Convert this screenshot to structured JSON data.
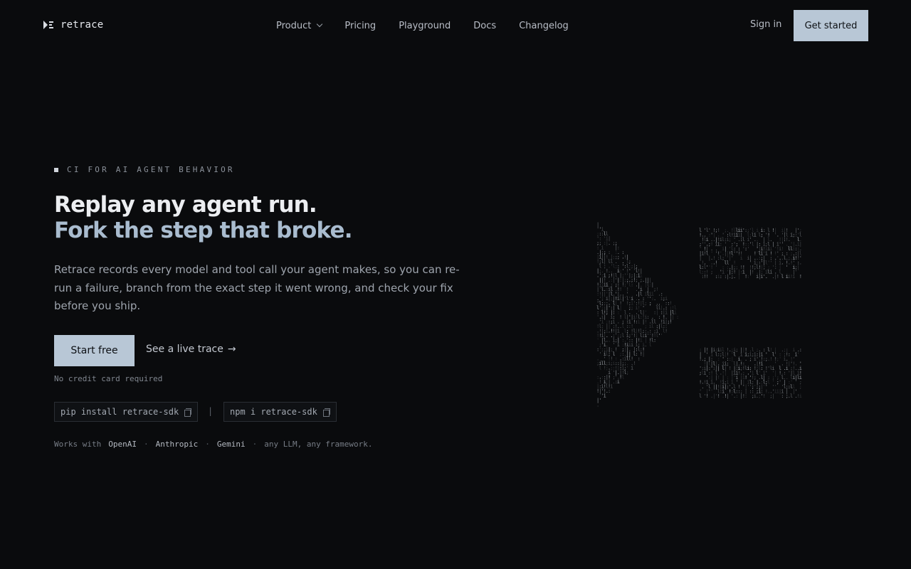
{
  "nav": {
    "logo": "retrace",
    "items": [
      {
        "label": "Product",
        "dropdown": true
      },
      {
        "label": "Pricing"
      },
      {
        "label": "Playground"
      },
      {
        "label": "Docs"
      },
      {
        "label": "Changelog"
      }
    ],
    "signin": "Sign in",
    "cta": "Get started"
  },
  "hero": {
    "eyebrow": "CI FOR AI AGENT BEHAVIOR",
    "title_line1": "Replay any agent run.",
    "title_line2": "Fork the step that broke.",
    "lede": "Retrace records every model and tool call your agent makes, so you can re-run a failure, branch from the exact step it went wrong, and check your fix before you ship.",
    "cta_primary": "Start free",
    "cta_secondary": "See a live trace",
    "cta_secondary_arrow": "→",
    "cta_note": "No credit card required",
    "install_pip": "pip install retrace-sdk",
    "install_sep": "|",
    "install_npm": "npm i retrace-sdk",
    "works_prefix": "Works with",
    "works_brands": [
      "OpenAI",
      "Anthropic",
      "Gemini"
    ],
    "works_dot": "·",
    "works_suffix": "any LLM, any framework."
  },
  "colors": {
    "background": "#0a0b0d",
    "accent": "#b8c7d6",
    "title_secondary": "#a9bccf"
  },
  "icons": {
    "logo": "play-bars-icon",
    "dropdown": "chevron-down-icon",
    "copy": "copy-icon",
    "arrow": "arrow-right-icon"
  }
}
